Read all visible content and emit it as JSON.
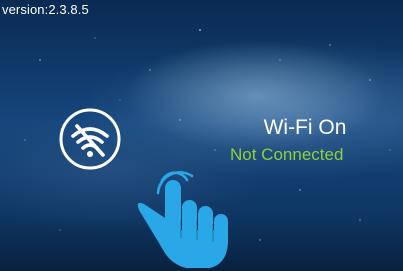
{
  "app": {
    "version": "version:2.3.8.5"
  },
  "wifi": {
    "state_label": "Wi-Fi On",
    "connection_label": "Not Connected",
    "icon": "wifi-off-icon"
  },
  "hint": {
    "icon": "tap-hand-icon"
  },
  "colors": {
    "connection_status": "#8fcf3b",
    "hand": "#29a7e6",
    "background": "#15467c"
  }
}
